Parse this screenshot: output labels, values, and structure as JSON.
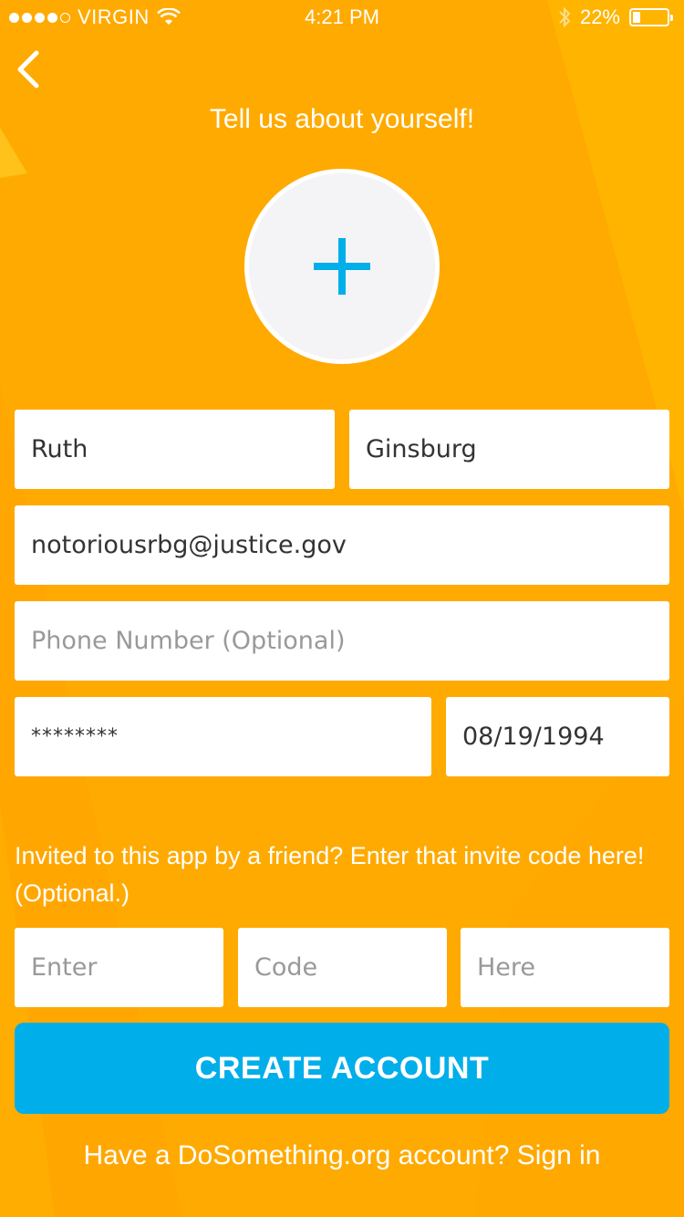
{
  "status_bar": {
    "carrier": "VIRGIN",
    "time": "4:21 PM",
    "battery_percent_label": "22%",
    "battery_level": 0.22
  },
  "header": {
    "title": "Tell us about yourself!"
  },
  "form": {
    "first_name_value": "Ruth",
    "last_name_value": "Ginsburg",
    "email_value": "notoriousrbg@justice.gov",
    "phone_placeholder": "Phone Number (Optional)",
    "password_value": "********",
    "birthday_value": "08/19/1994"
  },
  "invite": {
    "prompt_line1": "Invited to this app by a friend? Enter that invite code here!",
    "prompt_line2": "(Optional.)",
    "code_placeholders": [
      "Enter",
      "Code",
      "Here"
    ]
  },
  "actions": {
    "create_account_label": "CREATE ACCOUNT",
    "sign_in_prompt": "Have a DoSomething.org account? Sign in"
  },
  "colors": {
    "background": "#FFAA00",
    "accent_button": "#00AEEA",
    "plus_icon": "#00AEEA"
  },
  "icons": {
    "back": "chevron-left-icon",
    "add_photo": "plus-icon",
    "wifi": "wifi-icon",
    "bluetooth": "bluetooth-icon",
    "battery": "battery-icon"
  }
}
